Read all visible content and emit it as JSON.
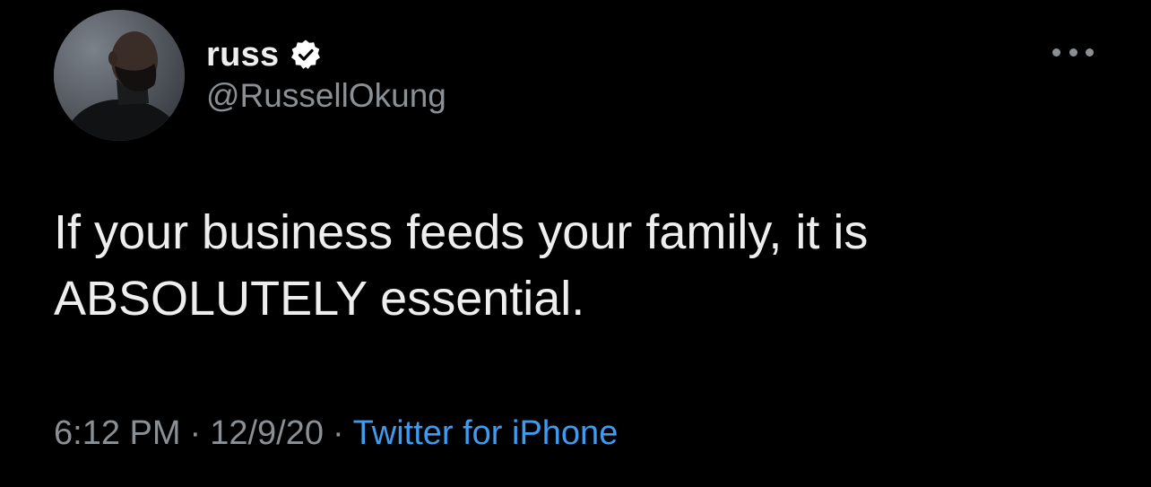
{
  "user": {
    "display_name": "russ",
    "handle": "@RussellOkung",
    "verified": true
  },
  "tweet": {
    "text": "If your business feeds your family, it is ABSOLUTELY essential.",
    "time": "6:12 PM",
    "date": "12/9/20",
    "separator": "·",
    "source": "Twitter for iPhone"
  },
  "icons": {
    "verified": "verified-badge-icon",
    "more": "more-horizontal-icon"
  },
  "colors": {
    "background": "#000000",
    "text": "#eeeeee",
    "secondary_text": "#8b9095",
    "link": "#3f9bf0"
  }
}
